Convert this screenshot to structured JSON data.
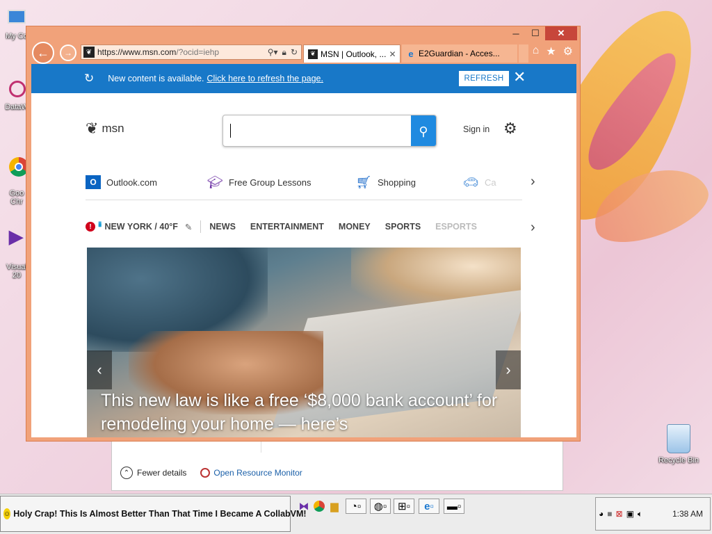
{
  "desktop": {
    "icons": [
      {
        "label": "My Co",
        "name": "my-computer"
      },
      {
        "label": "DataW",
        "name": "dataw"
      },
      {
        "label": "Goo\nChr",
        "name": "google-chrome"
      },
      {
        "label": "Visual\n20",
        "name": "visual-studio"
      }
    ],
    "recycle_bin": "Recycle Bin"
  },
  "background_window": {
    "fewer_details": "Fewer details",
    "open_resource_monitor": "Open Resource Monitor"
  },
  "browser": {
    "address": {
      "url_main": "https://www.msn.com",
      "url_rest": "/?ocid=iehp"
    },
    "tabs": [
      {
        "title": "MSN | Outlook, ...",
        "active": true
      },
      {
        "title": "E2Guardian - Acces...",
        "active": false
      }
    ],
    "notice": {
      "message": "New content is available.",
      "link": "Click here to refresh the page.",
      "button": "REFRESH"
    },
    "msn": {
      "logo": "msn",
      "signin": "Sign in",
      "quick_links": [
        {
          "label": "Outlook.com",
          "icon": "outlook-icon"
        },
        {
          "label": "Free Group Lessons",
          "icon": "graduation-cap-icon"
        },
        {
          "label": "Shopping",
          "icon": "shopping-cart-icon"
        },
        {
          "label": "Ca",
          "icon": "car-icon"
        }
      ],
      "weather": "NEW YORK / 40°F",
      "categories": [
        "NEWS",
        "ENTERTAINMENT",
        "MONEY",
        "SPORTS",
        "ESPORTS"
      ],
      "hero_headline": "This new law is like a free ‘$8,000 bank account’ for remodeling your home — here’s"
    }
  },
  "taskbar": {
    "title": "Holy Crap! This Is Almost Better Than That Time I Became A CollabVM!",
    "clock": "1:38 AM"
  },
  "colors": {
    "accent_blue": "#1878c8",
    "window_frame": "#f1a27a",
    "close_red": "#c7463a"
  }
}
